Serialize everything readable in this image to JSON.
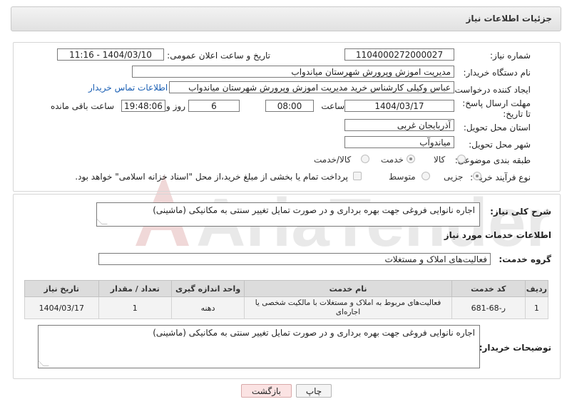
{
  "header": {
    "title": "جزئیات اطلاعات نیاز"
  },
  "form": {
    "need_number_label": "شماره نیاز:",
    "need_number": "1104000272000027",
    "announce_label": "تاریخ و ساعت اعلان عمومی:",
    "announce_value": "1404/03/10 - 11:16",
    "buyer_org_label": "نام دستگاه خریدار:",
    "buyer_org": "مدیریت اموزش وپرورش شهرستان میاندواب",
    "creator_label": "ایجاد کننده درخواست:",
    "creator": "عباس وکیلی کارشناس خرید مدیریت اموزش وپرورش شهرستان میاندواب",
    "contact_link": "اطلاعات تماس خریدار",
    "deadline_label": "مهلت ارسال پاسخ: تا تاریخ:",
    "deadline_date": "1404/03/17",
    "time_label": "ساعت",
    "deadline_time": "08:00",
    "days_value": "6",
    "days_label": "روز و",
    "remaining_time": "19:48:06",
    "remaining_label": "ساعت باقی مانده",
    "province_label": "استان محل تحویل:",
    "province": "آذربایجان غربی",
    "city_label": "شهر محل تحویل:",
    "city": "میاندوآب",
    "category_label": "طبقه بندی موضوعی:",
    "category_options": [
      "کالا",
      "خدمت",
      "کالا/خدمت"
    ],
    "category_selected": "خدمت",
    "process_label": "نوع فرآیند خرید :",
    "process_options": [
      "جزیی",
      "متوسط"
    ],
    "process_selected": "جزیی",
    "payment_note": "پرداخت تمام یا بخشی از مبلغ خرید،از محل \"اسناد خزانه اسلامی\" خواهد بود."
  },
  "details": {
    "summary_label": "شرح کلی نیاز:",
    "summary": "اجاره نانوایی فروغی جهت بهره برداری و در صورت تمایل تغییر سنتی به مکانیکی (ماشینی)",
    "services_title": "اطلاعات خدمات مورد نیاز",
    "group_label": "گروه خدمت:",
    "group": "فعالیت‌های  املاک و مستغلات",
    "table": {
      "headers": [
        "ردیف",
        "کد خدمت",
        "نام خدمت",
        "واحد اندازه گیری",
        "تعداد / مقدار",
        "تاریخ نیاز"
      ],
      "rows": [
        [
          "1",
          "ر-68-681",
          "فعالیت‌های مربوط به املاک و مستغلات با مالکیت شخصی یا اجاره‌ای",
          "دهنه",
          "1",
          "1404/03/17"
        ]
      ]
    },
    "buyer_desc_label": "توضیحات خریدار:",
    "buyer_desc": "اجاره نانوایی فروغی جهت بهره برداری و در صورت تمایل تغییر سنتی به مکانیکی (ماشینی)"
  },
  "buttons": {
    "print": "چاپ",
    "back": "بازگشت"
  },
  "watermark": {
    "text": "AriaTender.neT"
  },
  "colors": {
    "link": "#1a5fb4",
    "back_button_bg": "#fbe3e3",
    "header_bg": "#e6e6e6"
  }
}
